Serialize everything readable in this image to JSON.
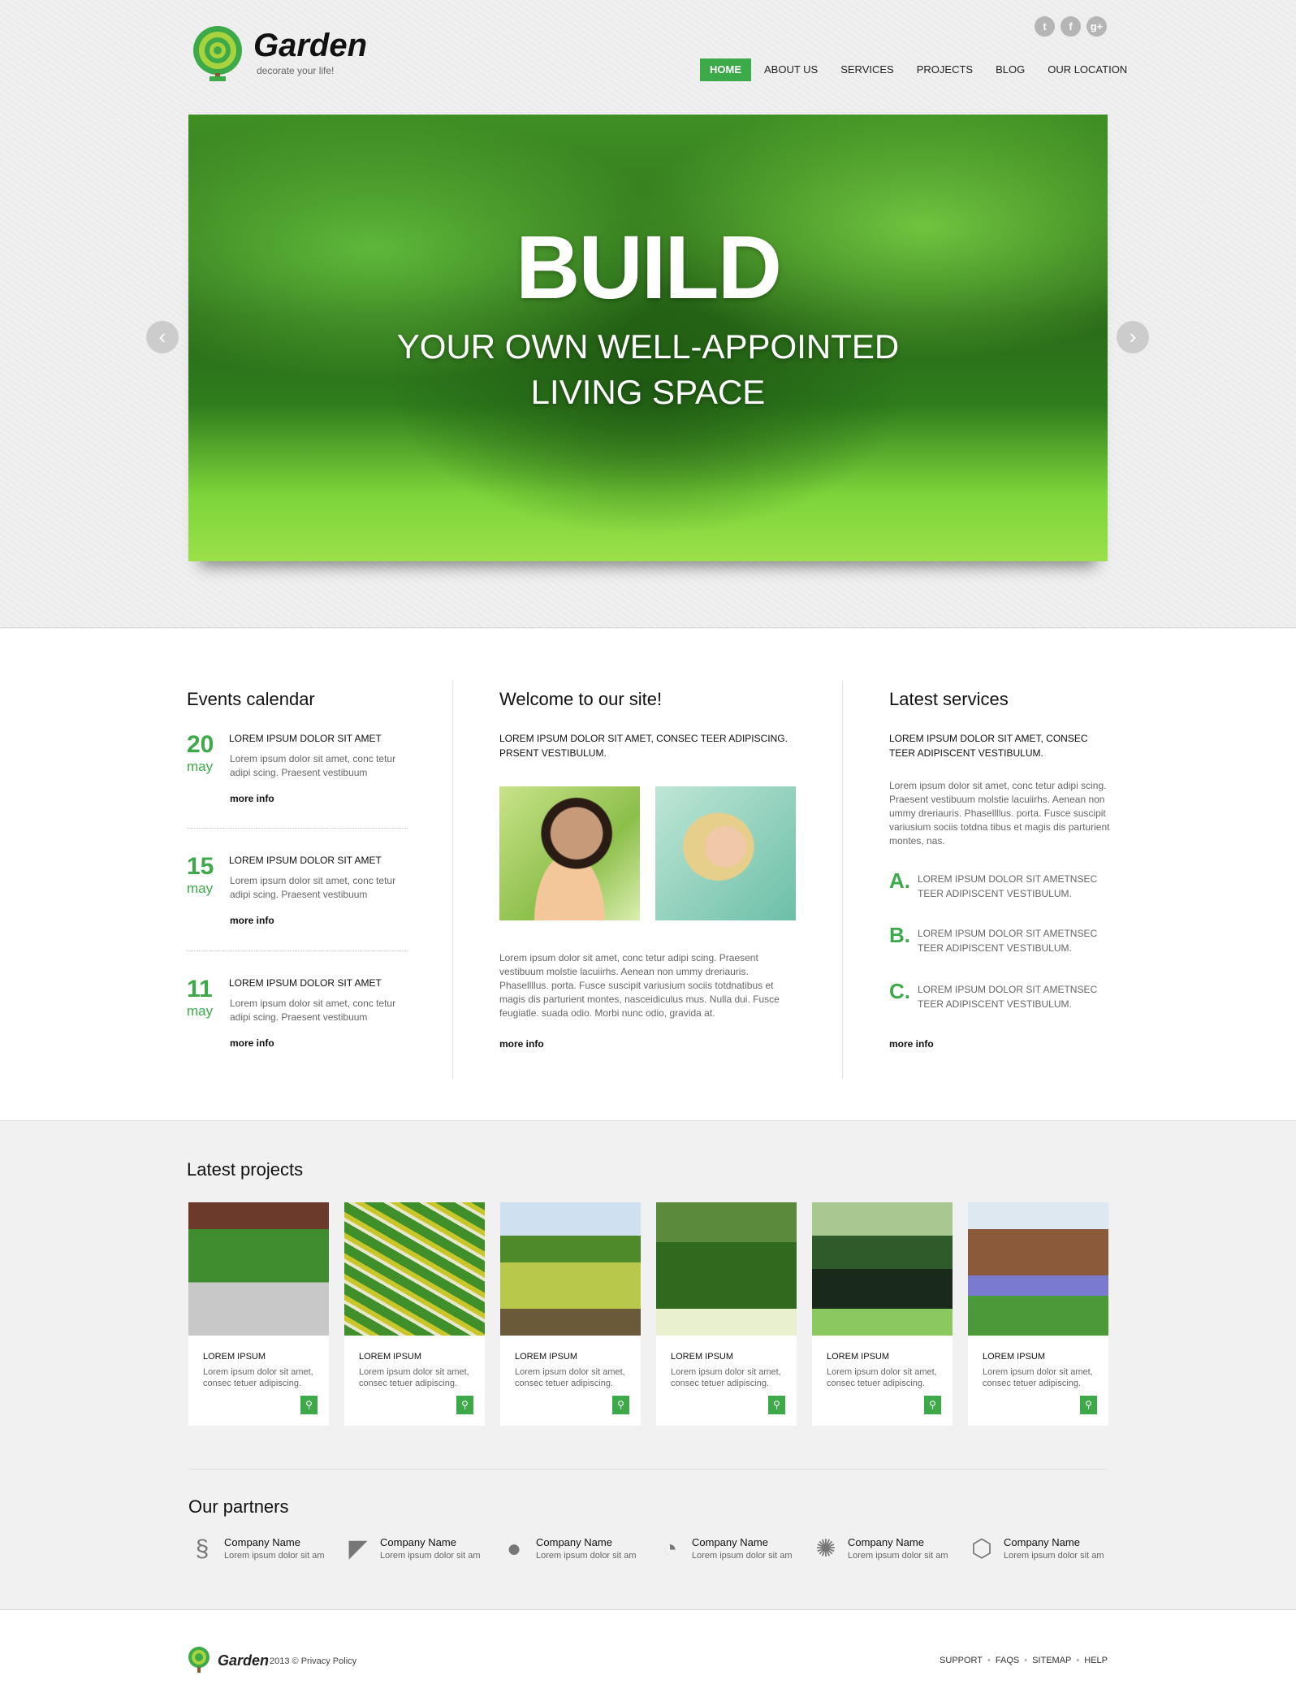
{
  "brand": {
    "name": "Garden",
    "tagline": "decorate your life!"
  },
  "social": [
    {
      "icon": "twitter-icon",
      "glyph": "t"
    },
    {
      "icon": "facebook-icon",
      "glyph": "f"
    },
    {
      "icon": "google-plus-icon",
      "glyph": "g+"
    }
  ],
  "nav": [
    {
      "label": "HOME",
      "active": true
    },
    {
      "label": "ABOUT US"
    },
    {
      "label": "SERVICES"
    },
    {
      "label": "PROJECTS"
    },
    {
      "label": "BLOG"
    },
    {
      "label": "OUR LOCATION"
    }
  ],
  "hero": {
    "title": "BUILD",
    "subtitle_line1": "YOUR OWN WELL-APPOINTED",
    "subtitle_line2": "LIVING SPACE",
    "prev": "‹",
    "next": "›"
  },
  "events": {
    "title": "Events calendar",
    "items": [
      {
        "day": "20",
        "month": "may",
        "title": "LOREM IPSUM DOLOR SIT AMET",
        "text": "Lorem ipsum dolor sit amet, conc tetur adipi scing. Praesent vestibuum",
        "more": "more info"
      },
      {
        "day": "15",
        "month": "may",
        "title": "LOREM IPSUM DOLOR SIT AMET",
        "text": "Lorem ipsum dolor sit amet, conc tetur adipi scing. Praesent vestibuum",
        "more": "more info"
      },
      {
        "day": "11",
        "month": "may",
        "title": "LOREM IPSUM DOLOR SIT AMET",
        "text": "Lorem ipsum dolor sit amet, conc tetur adipi scing. Praesent vestibuum",
        "more": "more info"
      }
    ]
  },
  "welcome": {
    "title": "Welcome to our site!",
    "lead": "LOREM IPSUM DOLOR SIT AMET, CONSEC TEER ADIPISCING. PRSENT VESTIBULUM.",
    "text": "Lorem ipsum dolor sit amet, conc tetur adipi scing. Praesent vestibuum molstie lacuiirhs. Aenean non ummy dreriauris. Phasellllus. porta. Fusce suscipit variusium sociis totdnatibus et magis dis parturient montes, nasceidiculus mus. Nulla dui. Fusce feugiatle. suada odio. Morbi nunc odio, gravida at.",
    "more": "more info"
  },
  "services": {
    "title": "Latest services",
    "lead": "LOREM IPSUM DOLOR SIT AMET, CONSEC TEER ADIPISCENT VESTIBULUM.",
    "text": "Lorem ipsum dolor sit amet, conc tetur adipi scing. Praesent vestibuum molstie lacuiirhs. Aenean non ummy dreriauris. Phasellllus. porta. Fusce suscipit variusium sociis totdna tibus et magis dis parturient montes, nas.",
    "items": [
      {
        "letter": "A.",
        "text": "LOREM IPSUM DOLOR SIT AMETNSEC TEER ADIPISCENT VESTIBULUM."
      },
      {
        "letter": "B.",
        "text": "LOREM IPSUM DOLOR SIT AMETNSEC TEER ADIPISCENT VESTIBULUM."
      },
      {
        "letter": "C.",
        "text": "LOREM IPSUM DOLOR SIT AMETNSEC TEER ADIPISCENT VESTIBULUM."
      }
    ],
    "more": "more info"
  },
  "projects": {
    "title": "Latest projects",
    "items": [
      {
        "title": "LOREM IPSUM",
        "text": "Lorem ipsum dolor sit amet, consec tetuer adipiscing."
      },
      {
        "title": "LOREM IPSUM",
        "text": "Lorem ipsum dolor sit amet, consec tetuer adipiscing."
      },
      {
        "title": "LOREM IPSUM",
        "text": "Lorem ipsum dolor sit amet, consec tetuer adipiscing."
      },
      {
        "title": "LOREM IPSUM",
        "text": "Lorem ipsum dolor sit amet, consec tetuer adipiscing."
      },
      {
        "title": "LOREM IPSUM",
        "text": "Lorem ipsum dolor sit amet, consec tetuer adipiscing."
      },
      {
        "title": "LOREM IPSUM",
        "text": "Lorem ipsum dolor sit amet, consec tetuer adipiscing."
      }
    ]
  },
  "partners": {
    "title": "Our partners",
    "items": [
      {
        "name": "Company Name",
        "text": "Lorem ipsum dolor sit am",
        "glyph": "§"
      },
      {
        "name": "Company Name",
        "text": "Lorem ipsum dolor sit am",
        "glyph": "◤"
      },
      {
        "name": "Company Name",
        "text": "Lorem ipsum dolor sit am",
        "glyph": "●"
      },
      {
        "name": "Company Name",
        "text": "Lorem ipsum dolor sit am",
        "glyph": "◔"
      },
      {
        "name": "Company Name",
        "text": "Lorem ipsum dolor sit am",
        "glyph": "✺"
      },
      {
        "name": "Company Name",
        "text": "Lorem ipsum dolor sit am",
        "glyph": "⬡"
      }
    ]
  },
  "footer": {
    "brand": "Garden",
    "copy": "2013 © Privacy Policy",
    "links": [
      "SUPPORT",
      "FAQS",
      "SITEMAP",
      "HELP"
    ]
  },
  "colors": {
    "accent": "#3daa4a"
  }
}
